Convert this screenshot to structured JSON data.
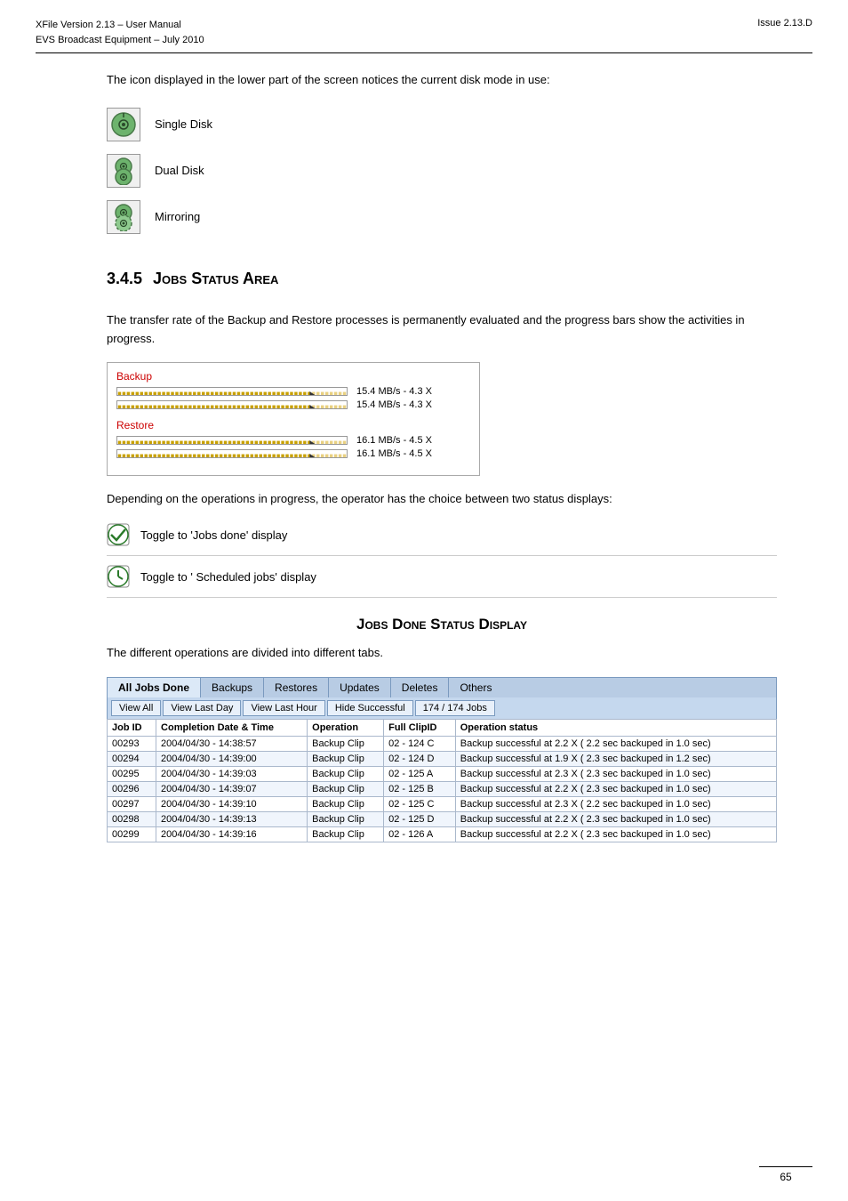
{
  "header": {
    "left_line1": "XFile Version 2.13 – User Manual",
    "left_line2": "EVS Broadcast Equipment – July 2010",
    "right": "Issue 2.13.D"
  },
  "intro": {
    "text": "The icon displayed in the lower part of the screen notices the current disk mode in use:"
  },
  "disk_modes": [
    {
      "id": "single",
      "label": "Single Disk"
    },
    {
      "id": "dual",
      "label": "Dual Disk"
    },
    {
      "id": "mirror",
      "label": "Mirroring"
    }
  ],
  "section_345": {
    "number": "3.4.5",
    "title": "Jobs Status Area"
  },
  "section_345_text": "The transfer rate of the Backup and Restore processes is permanently evaluated and the progress bars show the activities in progress.",
  "backup_label": "Backup",
  "backup_bar1": "15.4 MB/s - 4.3 X",
  "backup_bar2": "15.4 MB/s - 4.3 X",
  "restore_label": "Restore",
  "restore_bar1": "16.1 MB/s - 4.5 X",
  "restore_bar2": "16.1 MB/s - 4.5 X",
  "status_displays_text": "Depending on the operations in progress, the operator has the choice between two status displays:",
  "toggle_done": "Toggle to 'Jobs done' display",
  "toggle_scheduled": "Toggle to ' Scheduled jobs' display",
  "jobs_done_heading": "Jobs Done Status Display",
  "jobs_done_intro": "The different operations are divided into different tabs.",
  "tabs": [
    {
      "id": "all",
      "label": "All Jobs Done",
      "active": true
    },
    {
      "id": "backups",
      "label": "Backups",
      "active": false
    },
    {
      "id": "restores",
      "label": "Restores",
      "active": false
    },
    {
      "id": "updates",
      "label": "Updates",
      "active": false
    },
    {
      "id": "deletes",
      "label": "Deletes",
      "active": false
    },
    {
      "id": "others",
      "label": "Others",
      "active": false
    }
  ],
  "sub_buttons": [
    {
      "id": "view-all",
      "label": "View All"
    },
    {
      "id": "view-last-day",
      "label": "View Last Day"
    },
    {
      "id": "view-last-hour",
      "label": "View Last Hour"
    },
    {
      "id": "hide-successful",
      "label": "Hide Successful"
    }
  ],
  "jobs_counter": "174 / 174 Jobs",
  "table": {
    "columns": [
      "Job ID",
      "Completion Date & Time",
      "Operation",
      "Full ClipID",
      "Operation status"
    ],
    "rows": [
      {
        "job_id": "00293",
        "date_time": "2004/04/30 - 14:38:57",
        "operation": "Backup Clip",
        "clip_id": "02 - 124 C",
        "status": "Backup successful at 2.2 X ( 2.2 sec backuped in 1.0 sec)"
      },
      {
        "job_id": "00294",
        "date_time": "2004/04/30 - 14:39:00",
        "operation": "Backup Clip",
        "clip_id": "02 - 124 D",
        "status": "Backup successful at 1.9 X ( 2.3 sec backuped in 1.2 sec)"
      },
      {
        "job_id": "00295",
        "date_time": "2004/04/30 - 14:39:03",
        "operation": "Backup Clip",
        "clip_id": "02 - 125 A",
        "status": "Backup successful at 2.3 X ( 2.3 sec backuped in 1.0 sec)"
      },
      {
        "job_id": "00296",
        "date_time": "2004/04/30 - 14:39:07",
        "operation": "Backup Clip",
        "clip_id": "02 - 125 B",
        "status": "Backup successful at 2.2 X ( 2.3 sec backuped in 1.0 sec)"
      },
      {
        "job_id": "00297",
        "date_time": "2004/04/30 - 14:39:10",
        "operation": "Backup Clip",
        "clip_id": "02 - 125 C",
        "status": "Backup successful at 2.3 X ( 2.2 sec backuped in 1.0 sec)"
      },
      {
        "job_id": "00298",
        "date_time": "2004/04/30 - 14:39:13",
        "operation": "Backup Clip",
        "clip_id": "02 - 125 D",
        "status": "Backup successful at 2.2 X ( 2.3 sec backuped in 1.0 sec)"
      },
      {
        "job_id": "00299",
        "date_time": "2004/04/30 - 14:39:16",
        "operation": "Backup Clip",
        "clip_id": "02 - 126 A",
        "status": "Backup successful at 2.2 X ( 2.3 sec backuped in 1.0 sec)"
      }
    ]
  },
  "footer": {
    "page": "65"
  }
}
